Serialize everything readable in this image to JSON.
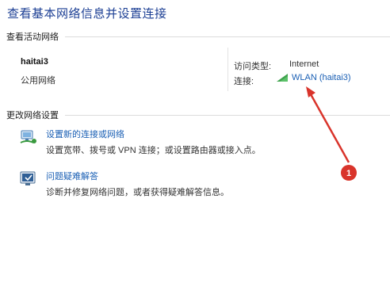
{
  "page_title": "查看基本网络信息并设置连接",
  "active_networks": {
    "header": "查看活动网络",
    "network_name": "haitai3",
    "network_type": "公用网络",
    "access_type_label": "访问类型:",
    "access_type_value": "Internet",
    "connections_label": "连接:",
    "connection_link": "WLAN (haitai3)",
    "connection_icon": "wifi-signal-icon"
  },
  "change_settings": {
    "header": "更改网络设置",
    "tasks": [
      {
        "link": "设置新的连接或网络",
        "description": "设置宽带、拨号或 VPN 连接；或设置路由器或接入点。",
        "icon": "network-setup-icon"
      },
      {
        "link": "问题疑难解答",
        "description": "诊断并修复网络问题，或者获得疑难解答信息。",
        "icon": "troubleshoot-icon"
      }
    ]
  },
  "annotation": {
    "marker": "1",
    "color": "#d9342b"
  },
  "colors": {
    "title": "#1c3f94",
    "link": "#1a5fb4",
    "annotation": "#d9342b"
  }
}
